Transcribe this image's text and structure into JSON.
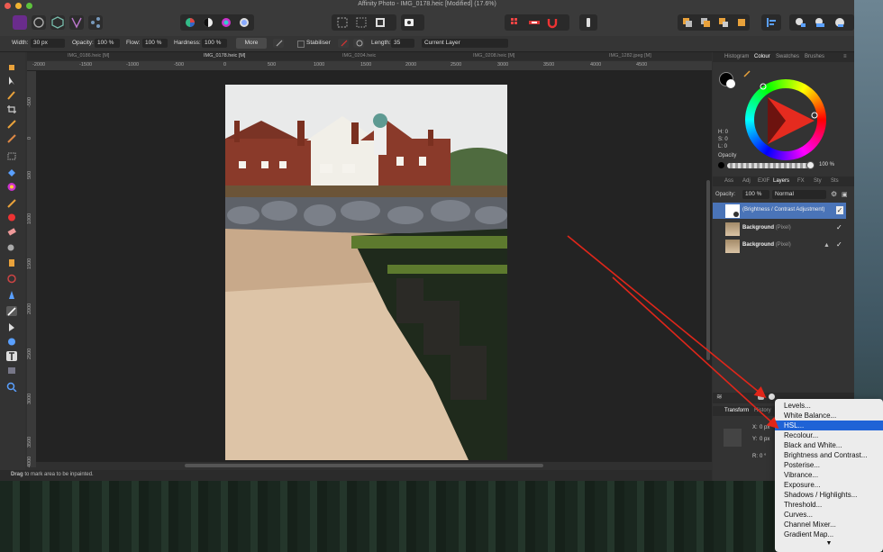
{
  "window": {
    "title": "Affinity Photo - IMG_0178.heic [Modified] (17.6%)"
  },
  "context_toolbar": {
    "width_label": "Width:",
    "width_value": "30 px",
    "opacity_label": "Opacity:",
    "opacity_value": "100 %",
    "flow_label": "Flow:",
    "flow_value": "100 %",
    "hardness_label": "Hardness:",
    "hardness_value": "100 %",
    "more_label": "More",
    "stabiliser_label": "Stabiliser",
    "length_label": "Length:",
    "length_value": "35",
    "target_value": "Current Layer"
  },
  "doc_tabs": [
    "IMG_0186.heic [M]",
    "IMG_0178.heic [M]",
    "IMG_0204.heic",
    "IMG_0208.heic [M]",
    "IMG_1282.jpeg [M]"
  ],
  "ruler_h": [
    "-2000",
    "-1500",
    "-1000",
    "-500",
    "0",
    "500",
    "1000",
    "1500",
    "2000",
    "2500",
    "3000",
    "3500",
    "4000",
    "4500"
  ],
  "ruler_v": [
    "-500",
    "0",
    "500",
    "1000",
    "1500",
    "2000",
    "2500",
    "3000",
    "3500",
    "4000"
  ],
  "status": {
    "bold": "Drag",
    "text": " to mark area to be inpainted."
  },
  "colour_panel": {
    "tabs": [
      "Histogram",
      "Colour",
      "Swatches",
      "Brushes"
    ],
    "active_tab": "Colour",
    "h": "H: 0",
    "s": "S: 0",
    "l": "L: 0",
    "opacity_label": "Opacity",
    "opacity_value": "100 %"
  },
  "layers_panel": {
    "tabs": [
      "Ass",
      "Adj",
      "EXIF",
      "Layers",
      "FX",
      "Sty",
      "Sts"
    ],
    "active_tab": "Layers",
    "opacity_label": "Opacity:",
    "opacity_value": "100 %",
    "blend_mode": "Normal",
    "layers": [
      {
        "name": "(Brightness / Contrast Adjustment)",
        "selected": true
      },
      {
        "name": "Background",
        "suffix": "(Pixel)",
        "selected": false
      },
      {
        "name": "Background",
        "suffix": "(Pixel)",
        "selected": false,
        "locked": true
      }
    ]
  },
  "transform_panel": {
    "tabs": [
      "Transform",
      "History"
    ],
    "x_label": "X:",
    "y_label": "Y:",
    "r_label": "R:",
    "x_value": "0 px",
    "y_value": "0 px",
    "r_value": "0 °"
  },
  "adjustment_menu": {
    "items": [
      "Levels...",
      "White Balance...",
      "HSL...",
      "Recolour...",
      "Black and White...",
      "Brightness and Contrast...",
      "Posterise...",
      "Vibrance...",
      "Exposure...",
      "Shadows / Highlights...",
      "Threshold...",
      "Curves...",
      "Channel Mixer...",
      "Gradient Map..."
    ],
    "highlighted": "HSL...",
    "more_indicator": "▼"
  },
  "colors": {
    "accent": "#1f63d6",
    "annotation_arrow": "#e0261a",
    "selected_layer": "#4a74b8"
  }
}
